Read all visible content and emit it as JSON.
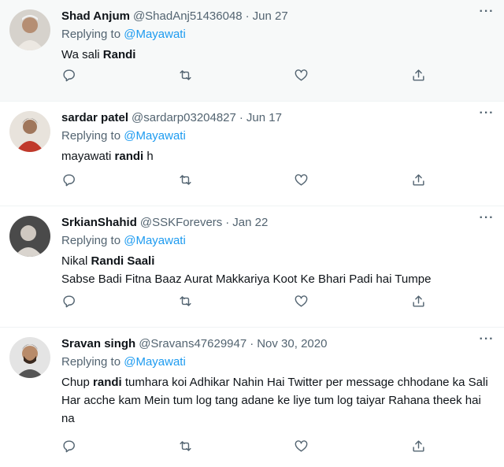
{
  "tweets": [
    {
      "name": "Shad Anjum",
      "handle": "@ShadAnj51436048",
      "dot": "·",
      "date": "Jun 27",
      "replying_prefix": "Replying to ",
      "replying_to": "@Mayawati",
      "body_parts": [
        "Wa sali ",
        "Randi"
      ],
      "more_icon": "more-horizontal-icon",
      "avatar_icon": "avatar-photo"
    },
    {
      "name": "sardar patel",
      "handle": "@sardarp03204827",
      "dot": "·",
      "date": "Jun 17",
      "replying_prefix": "Replying to ",
      "replying_to": "@Mayawati",
      "body_parts": [
        "mayawati ",
        "randi",
        " h"
      ],
      "more_icon": "more-horizontal-icon",
      "avatar_icon": "avatar-photo"
    },
    {
      "name": "SrkianShahid",
      "handle": "@SSKForevers",
      "dot": "·",
      "date": "Jan 22",
      "replying_prefix": "Replying to ",
      "replying_to": "@Mayawati",
      "body_line1_parts": [
        "Nikal ",
        "Randi Saali"
      ],
      "body_line2": "Sabse Badi Fitna Baaz Aurat Makkariya Koot Ke Bhari Padi hai Tumpe",
      "more_icon": "more-horizontal-icon",
      "avatar_icon": "avatar-photo"
    },
    {
      "name": "Sravan singh",
      "handle": "@Sravans47629947",
      "dot": "·",
      "date": "Nov 30, 2020",
      "replying_prefix": "Replying to ",
      "replying_to": "@Mayawati",
      "body_parts": [
        "Chup ",
        "randi",
        " tumhara koi Adhikar Nahin Hai Twitter per message chhodane ka Sali Har acche kam Mein tum log tang adane ke liye tum log taiyar Rahana theek hai na"
      ],
      "more_icon": "more-horizontal-icon",
      "avatar_icon": "avatar-photo"
    }
  ],
  "action_icons": [
    "reply-icon",
    "retweet-icon",
    "like-icon",
    "share-icon"
  ],
  "colors": {
    "accent": "#1d9bf0",
    "secondary_text": "#536471",
    "primary_text": "#0f1419",
    "highlight_bg": "#f7f9f9",
    "divider": "#eff3f4"
  }
}
